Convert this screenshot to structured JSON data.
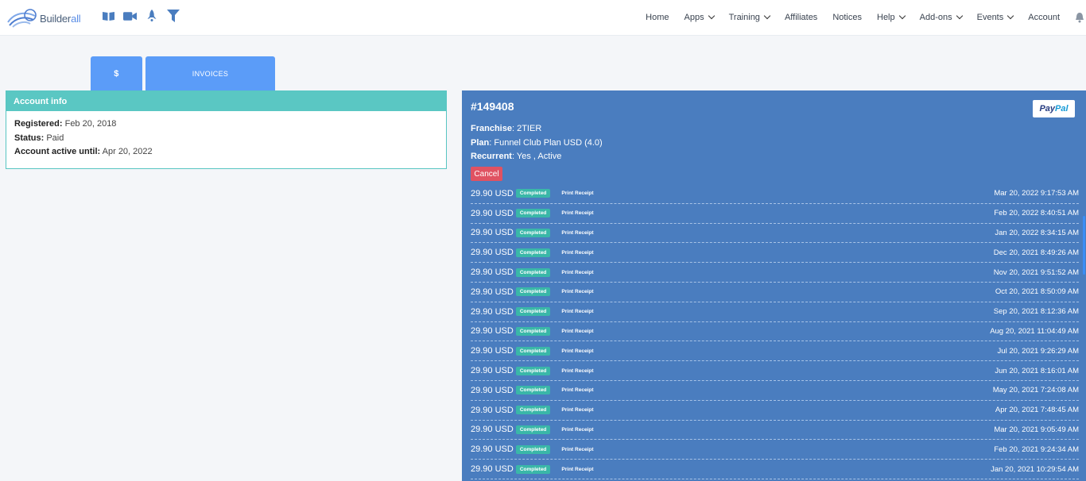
{
  "brand": {
    "name_a": "Builder",
    "name_b": "all"
  },
  "toolbar_icons": [
    "book-icon",
    "video-camera-icon",
    "rocket-icon",
    "filter-icon"
  ],
  "nav": [
    {
      "label": "Home",
      "dropdown": false
    },
    {
      "label": "Apps",
      "dropdown": true
    },
    {
      "label": "Training",
      "dropdown": true
    },
    {
      "label": "Affiliates",
      "dropdown": false
    },
    {
      "label": "Notices",
      "dropdown": false
    },
    {
      "label": "Help",
      "dropdown": true
    },
    {
      "label": "Add-ons",
      "dropdown": true
    },
    {
      "label": "Events",
      "dropdown": true
    },
    {
      "label": "Account",
      "dropdown": false
    }
  ],
  "tabs": {
    "dollar": "$",
    "invoices": "INVOICES"
  },
  "account": {
    "title": "Account info",
    "registered_label": "Registered:",
    "registered": "Feb 20, 2018",
    "status_label": "Status:",
    "status": "Paid",
    "active_label": "Account active until:",
    "active_until": "Apr 20, 2022"
  },
  "invoice": {
    "id": "#149408",
    "gateway": {
      "a": "Pay",
      "b": "Pal"
    },
    "franchise_label": "Franchise",
    "franchise": "2TIER",
    "plan_label": "Plan",
    "plan": "Funnel Club Plan USD (4.0)",
    "recurrent_label": "Recurrent",
    "recurrent": "Yes , Active",
    "cancel_label": "Cancel",
    "status_badge": "Completed",
    "receipt_label": "Print Receipt",
    "payments": [
      {
        "amount": "29.90 USD",
        "date": "Mar 20, 2022 9:17:53 AM"
      },
      {
        "amount": "29.90 USD",
        "date": "Feb 20, 2022 8:40:51 AM"
      },
      {
        "amount": "29.90 USD",
        "date": "Jan 20, 2022 8:34:15 AM"
      },
      {
        "amount": "29.90 USD",
        "date": "Dec 20, 2021 8:49:26 AM"
      },
      {
        "amount": "29.90 USD",
        "date": "Nov 20, 2021 9:51:52 AM"
      },
      {
        "amount": "29.90 USD",
        "date": "Oct 20, 2021 8:50:09 AM"
      },
      {
        "amount": "29.90 USD",
        "date": "Sep 20, 2021 8:12:36 AM"
      },
      {
        "amount": "29.90 USD",
        "date": "Aug 20, 2021 11:04:49 AM"
      },
      {
        "amount": "29.90 USD",
        "date": "Jul 20, 2021 9:26:29 AM"
      },
      {
        "amount": "29.90 USD",
        "date": "Jun 20, 2021 8:16:01 AM"
      },
      {
        "amount": "29.90 USD",
        "date": "May 20, 2021 7:24:08 AM"
      },
      {
        "amount": "29.90 USD",
        "date": "Apr 20, 2021 7:48:45 AM"
      },
      {
        "amount": "29.90 USD",
        "date": "Mar 20, 2021 9:05:49 AM"
      },
      {
        "amount": "29.90 USD",
        "date": "Feb 20, 2021 9:24:34 AM"
      },
      {
        "amount": "29.90 USD",
        "date": "Jan 20, 2021 10:29:54 AM"
      }
    ]
  },
  "colors": {
    "accent": "#5b9cf8",
    "panel": "#4a7dbf",
    "teal": "#5ac7c3",
    "cancel": "#e05262",
    "badge": "#3ab7a8"
  }
}
